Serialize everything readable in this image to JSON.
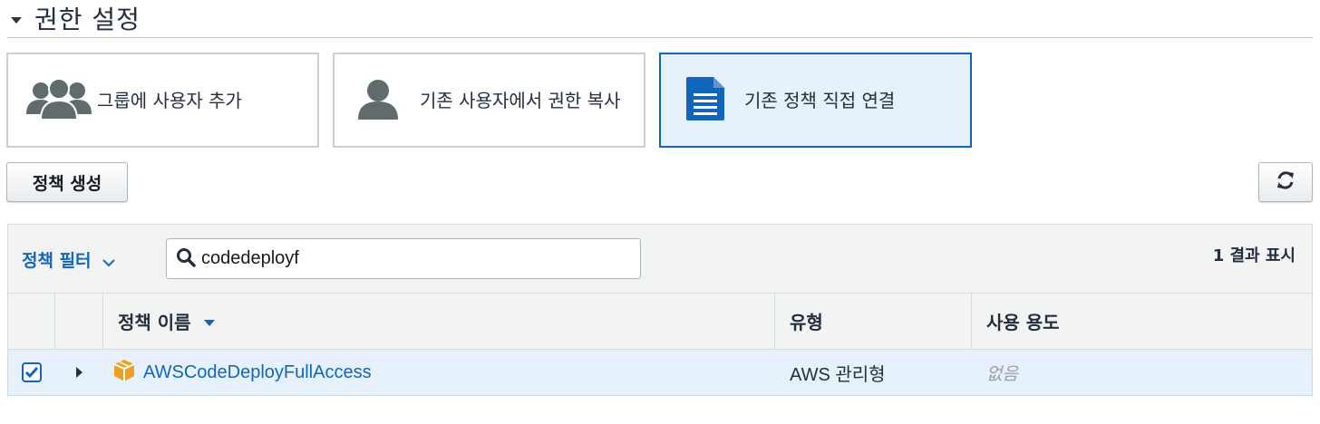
{
  "section": {
    "title": "권한 설정"
  },
  "options": [
    {
      "label": "그룹에 사용자 추가",
      "icon": "users-group-icon",
      "selected": false
    },
    {
      "label": "기존 사용자에서 권한 복사",
      "icon": "user-icon",
      "selected": false
    },
    {
      "label": "기존 정책 직접 연결",
      "icon": "document-icon",
      "selected": true
    }
  ],
  "toolbar": {
    "create_policy_label": "정책 생성",
    "refresh_icon": "refresh-icon"
  },
  "filter": {
    "dropdown_label": "정책 필터",
    "search_value": "codedeployf",
    "result_count": "1 결과 표시"
  },
  "table": {
    "columns": {
      "name": "정책 이름",
      "type": "유형",
      "usage": "사용 용도"
    },
    "rows": [
      {
        "checked": true,
        "name": "AWSCodeDeployFullAccess",
        "type": "AWS 관리형",
        "usage": "없음"
      }
    ]
  },
  "colors": {
    "accent": "#1166bb",
    "selected_bg": "#e7f1fb",
    "policy_icon": "#f0a020"
  }
}
